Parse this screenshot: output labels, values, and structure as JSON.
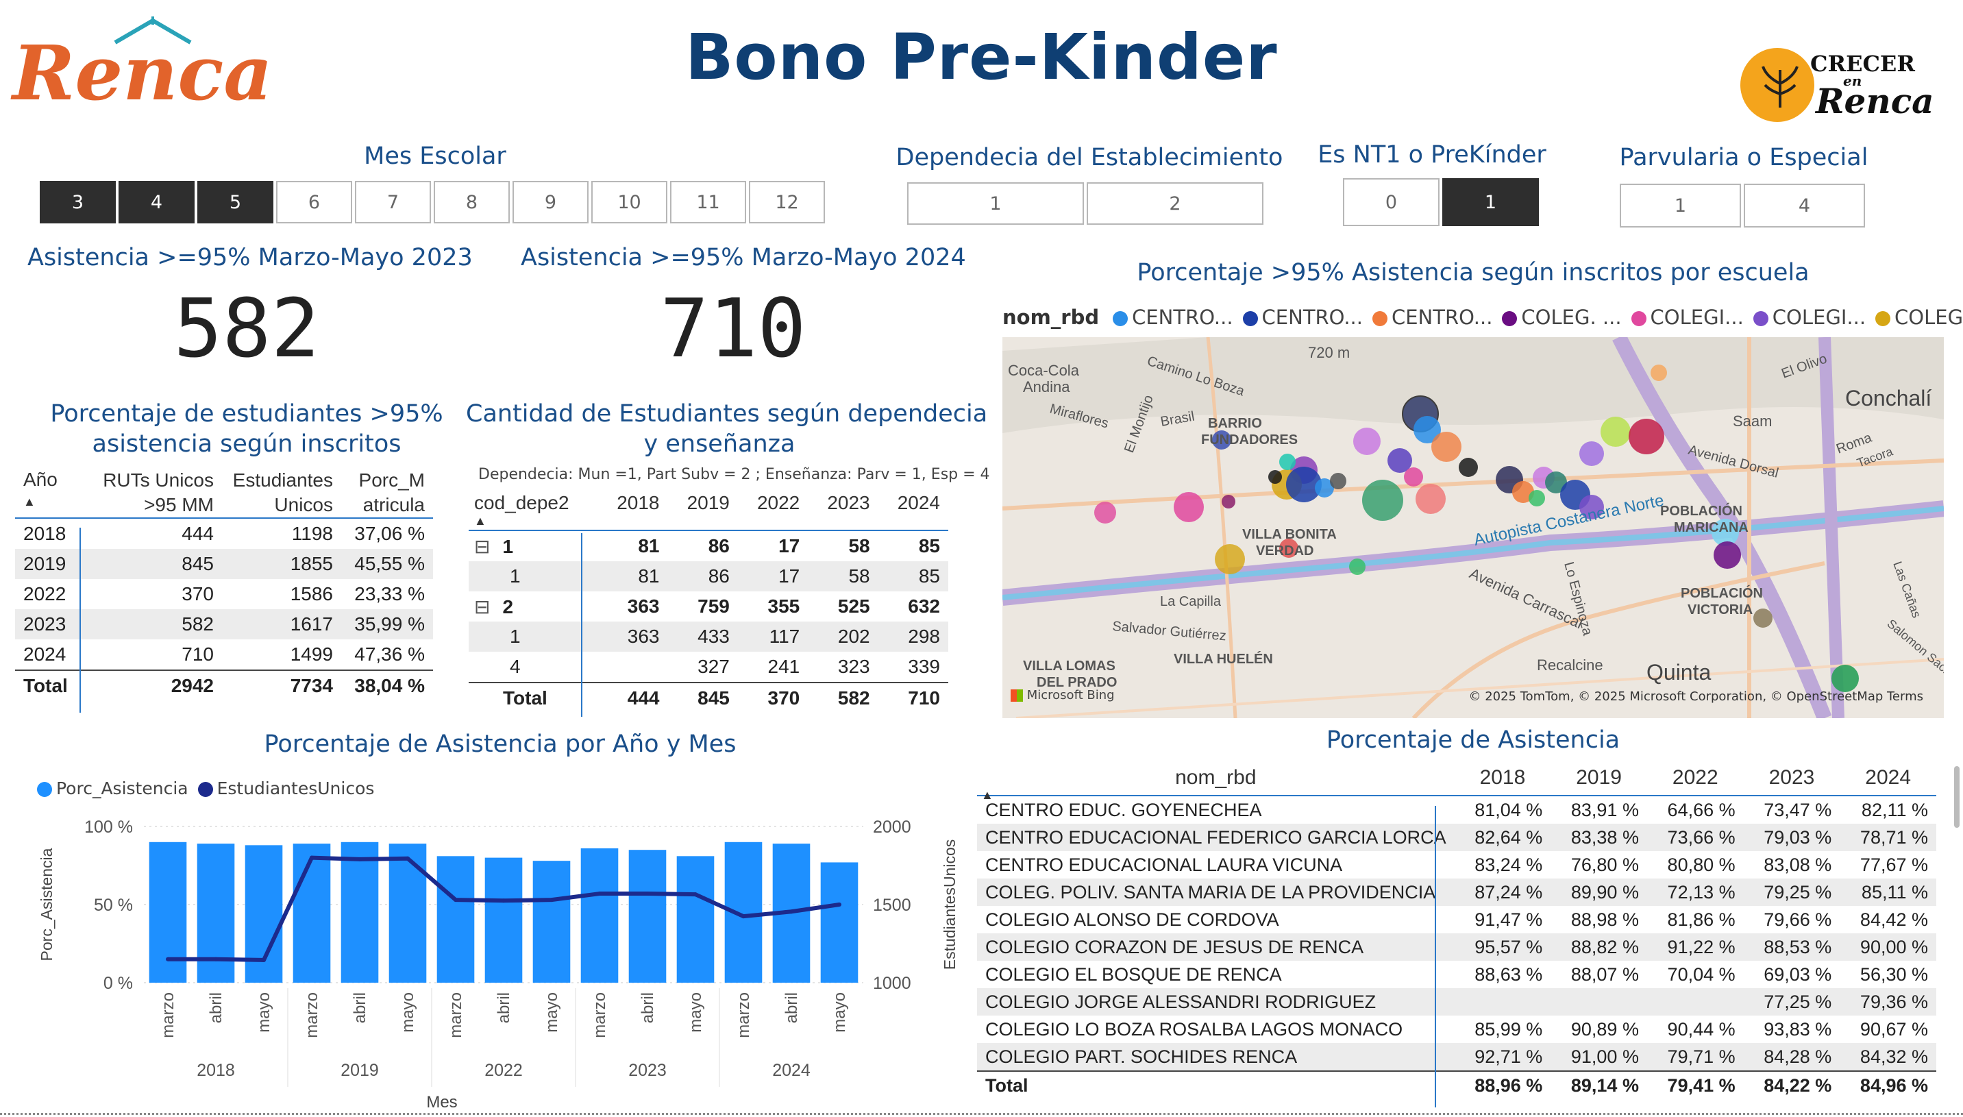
{
  "header": {
    "title": "Bono Pre-Kinder",
    "logo_left_text": "Renca",
    "logo_right_text": [
      "CRECER",
      "en",
      "Renca"
    ]
  },
  "slicers": {
    "mes": {
      "title": "Mes Escolar",
      "options": [
        "3",
        "4",
        "5",
        "6",
        "7",
        "8",
        "9",
        "10",
        "11",
        "12"
      ],
      "selected": [
        "3",
        "4",
        "5"
      ]
    },
    "dependencia": {
      "title": "Dependecia del Establecimiento",
      "options": [
        "1",
        "2"
      ],
      "selected": []
    },
    "nt1": {
      "title": "Es NT1 o PreKínder",
      "options": [
        "0",
        "1"
      ],
      "selected": [
        "1"
      ]
    },
    "parvularia": {
      "title": "Parvularia o Especial",
      "options": [
        "1",
        "4"
      ],
      "selected": []
    }
  },
  "kpis": {
    "k2023": {
      "title": "Asistencia >=95% Marzo-Mayo 2023",
      "value": "582"
    },
    "k2024": {
      "title": "Asistencia >=95% Marzo-Mayo 2024",
      "value": "710"
    }
  },
  "pct_table": {
    "title_line1": "Porcentaje de estudiantes >95%",
    "title_line2": "asistencia según inscritos",
    "headers": [
      "Año",
      "RUTs Unicos >95 MM",
      "Estudiantes Unicos",
      "Porc_Matricula"
    ],
    "rows": [
      [
        "2018",
        "444",
        "1198",
        "37,06 %"
      ],
      [
        "2019",
        "845",
        "1855",
        "45,55 %"
      ],
      [
        "2022",
        "370",
        "1586",
        "23,33 %"
      ],
      [
        "2023",
        "582",
        "1617",
        "35,99 %"
      ],
      [
        "2024",
        "710",
        "1499",
        "47,36 %"
      ]
    ],
    "total": [
      "Total",
      "2942",
      "7734",
      "38,04 %"
    ]
  },
  "dep_table": {
    "title_line1": "Cantidad de Estudiantes según dependecia",
    "title_line2": "y enseñanza",
    "note": "Dependecia: Mun =1,  Part Subv = 2 ; Enseñanza: Parv = 1, Esp = 4",
    "headers": [
      "cod_depe2",
      "2018",
      "2019",
      "2022",
      "2023",
      "2024"
    ],
    "rows": [
      {
        "label": "1",
        "expander": "⊟",
        "bold": true,
        "values": [
          "81",
          "86",
          "17",
          "58",
          "85"
        ]
      },
      {
        "label": "1",
        "expander": "",
        "bold": false,
        "values": [
          "81",
          "86",
          "17",
          "58",
          "85"
        ]
      },
      {
        "label": "2",
        "expander": "⊟",
        "bold": true,
        "values": [
          "363",
          "759",
          "355",
          "525",
          "632"
        ]
      },
      {
        "label": "1",
        "expander": "",
        "bold": false,
        "values": [
          "363",
          "433",
          "117",
          "202",
          "298"
        ]
      },
      {
        "label": "4",
        "expander": "",
        "bold": false,
        "values": [
          "",
          "327",
          "241",
          "323",
          "339"
        ]
      }
    ],
    "total": {
      "label": "Total",
      "values": [
        "444",
        "845",
        "370",
        "582",
        "710"
      ]
    }
  },
  "map": {
    "title": "Porcentaje >95% Asistencia según inscritos por escuela",
    "legend_label": "nom_rbd",
    "legend": [
      {
        "name": "CENTRO...",
        "color": "#2a8ee8"
      },
      {
        "name": "CENTRO...",
        "color": "#1d3fa8"
      },
      {
        "name": "CENTRO...",
        "color": "#f07a3a"
      },
      {
        "name": "COLEG. ...",
        "color": "#6a0d82"
      },
      {
        "name": "COLEGI...",
        "color": "#e0489e"
      },
      {
        "name": "COLEGI...",
        "color": "#7a4fc9"
      },
      {
        "name": "COLEGI...",
        "color": "#d6a614"
      }
    ],
    "labels": [
      "Coca-Cola Andina",
      "Camino Lo Boza",
      "El Montijo",
      "Brasil",
      "Miraflores",
      "BARRIO FUNDADORES",
      "720 m",
      "Conchalí",
      "El Olivo",
      "Saam",
      "Roma",
      "Tacora",
      "POBLACIÓN MARICANA",
      "POBLACIÓN VICTORIA",
      "Autopista Costanera Norte",
      "Avenida Carrascal",
      "VILLA BONITA VERDAD",
      "La Capilla",
      "Salvador Gutiérrez",
      "VILLA LOMAS DEL PRADO",
      "VILLA HUELÉN",
      "Recalcine",
      "Quinta",
      "Las Cañas",
      "Salomon Sack",
      "Avenida Dorsal",
      "Lo Espinoza"
    ],
    "bing": "Microsoft Bing",
    "copyright": "© 2025 TomTom, © 2025 Microsoft Corporation, © OpenStreetMap  Terms"
  },
  "chart_data": {
    "type": "bar",
    "title": "Porcentaje de Asistencia por Año y Mes",
    "legend": [
      "Porc_Asistencia",
      "EstudiantesUnicos"
    ],
    "categories": [
      "marzo",
      "abril",
      "mayo",
      "marzo",
      "abril",
      "mayo",
      "marzo",
      "abril",
      "mayo",
      "marzo",
      "abril",
      "mayo",
      "marzo",
      "abril",
      "mayo"
    ],
    "years": [
      "2018",
      "2019",
      "2022",
      "2023",
      "2024"
    ],
    "series": [
      {
        "name": "Porc_Asistencia",
        "type": "bar",
        "axis": "left",
        "values": [
          90,
          89,
          88,
          89,
          90,
          89,
          81,
          80,
          78,
          86,
          85,
          81,
          90,
          89,
          77
        ]
      },
      {
        "name": "EstudiantesUnicos",
        "type": "line",
        "axis": "right",
        "values": [
          1150,
          1150,
          1145,
          1800,
          1790,
          1795,
          1530,
          1525,
          1530,
          1570,
          1570,
          1565,
          1425,
          1455,
          1500
        ]
      }
    ],
    "ylabel": "Porc_Asistencia",
    "y2label": "EstudiantesUnicos",
    "xlabel": "Mes",
    "ylim": [
      0,
      100
    ],
    "yticks": [
      "100 %",
      "50 %",
      "0 %"
    ],
    "y2lim": [
      1000,
      2000
    ],
    "y2ticks": [
      "2000",
      "1500",
      "1000"
    ],
    "colors": {
      "bar": "#1e90ff",
      "line": "#1c2a8c"
    }
  },
  "attendance": {
    "title": "Porcentaje de Asistencia",
    "headers": [
      "nom_rbd",
      "2018",
      "2019",
      "2022",
      "2023",
      "2024"
    ],
    "rows": [
      [
        "CENTRO EDUC. GOYENECHEA",
        "81,04 %",
        "83,91 %",
        "64,66 %",
        "73,47 %",
        "82,11 %"
      ],
      [
        "CENTRO EDUCACIONAL FEDERICO GARCIA LORCA",
        "82,64 %",
        "83,38 %",
        "73,66 %",
        "79,03 %",
        "78,71 %"
      ],
      [
        "CENTRO EDUCACIONAL LAURA VICUNA",
        "83,24 %",
        "76,80 %",
        "80,80 %",
        "83,08 %",
        "77,67 %"
      ],
      [
        "COLEG. POLIV. SANTA MARIA DE LA PROVIDENCIA",
        "87,24 %",
        "89,90 %",
        "72,13 %",
        "79,25 %",
        "85,11 %"
      ],
      [
        "COLEGIO ALONSO DE CORDOVA",
        "91,47 %",
        "88,98 %",
        "81,86 %",
        "79,66 %",
        "84,42 %"
      ],
      [
        "COLEGIO CORAZON DE JESUS DE RENCA",
        "95,57 %",
        "88,82 %",
        "91,22 %",
        "88,53 %",
        "90,00 %"
      ],
      [
        "COLEGIO EL BOSQUE DE RENCA",
        "88,63 %",
        "88,07 %",
        "70,04 %",
        "69,03 %",
        "56,30 %"
      ],
      [
        "COLEGIO JORGE ALESSANDRI RODRIGUEZ",
        "",
        "",
        "",
        "77,25 %",
        "79,36 %"
      ],
      [
        "COLEGIO LO BOZA ROSALBA LAGOS MONACO",
        "85,99 %",
        "90,89 %",
        "90,44 %",
        "93,83 %",
        "90,67 %"
      ],
      [
        "COLEGIO PART. SOCHIDES RENCA",
        "92,71 %",
        "91,00 %",
        "79,71 %",
        "84,28 %",
        "84,32 %"
      ]
    ],
    "total": [
      "Total",
      "88,96 %",
      "89,14 %",
      "79,41 %",
      "84,22 %",
      "84,96 %"
    ]
  }
}
